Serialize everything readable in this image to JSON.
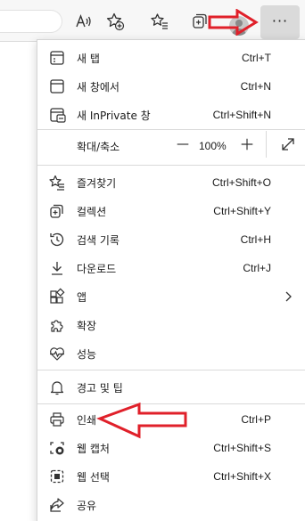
{
  "toolbar": {
    "icons": [
      "read-aloud-icon",
      "add-favorite-icon",
      "favorites-icon",
      "collections-icon",
      "profile-avatar",
      "more-options-icon"
    ],
    "more_label": "···"
  },
  "menu": {
    "new_tab": {
      "label": "새 탭",
      "shortcut": "Ctrl+T",
      "icon": "new-tab-icon"
    },
    "new_window": {
      "label": "새 창에서",
      "shortcut": "Ctrl+N",
      "icon": "new-window-icon"
    },
    "new_inprivate": {
      "label": "새 InPrivate 창",
      "shortcut": "Ctrl+Shift+N",
      "icon": "inprivate-icon"
    },
    "zoom": {
      "label": "확대/축소",
      "value": "100%",
      "minus": "—",
      "plus": "+"
    },
    "favorites": {
      "label": "즐겨찾기",
      "shortcut": "Ctrl+Shift+O",
      "icon": "favorites-icon"
    },
    "collections": {
      "label": "컬렉션",
      "shortcut": "Ctrl+Shift+Y",
      "icon": "collections-icon"
    },
    "history": {
      "label": "검색 기록",
      "shortcut": "Ctrl+H",
      "icon": "history-icon"
    },
    "downloads": {
      "label": "다운로드",
      "shortcut": "Ctrl+J",
      "icon": "download-icon"
    },
    "apps": {
      "label": "앱",
      "shortcut": "",
      "icon": "apps-icon"
    },
    "extensions": {
      "label": "확장",
      "shortcut": "",
      "icon": "extensions-icon"
    },
    "performance": {
      "label": "성능",
      "shortcut": "",
      "icon": "performance-icon"
    },
    "alerts": {
      "label": "경고 및 팁",
      "shortcut": "",
      "icon": "bell-icon"
    },
    "print": {
      "label": "인쇄",
      "shortcut": "Ctrl+P",
      "icon": "printer-icon"
    },
    "web_capture": {
      "label": "웹 캡처",
      "shortcut": "Ctrl+Shift+S",
      "icon": "web-capture-icon"
    },
    "web_select": {
      "label": "웹 선택",
      "shortcut": "Ctrl+Shift+X",
      "icon": "web-select-icon"
    },
    "share": {
      "label": "공유",
      "shortcut": "",
      "icon": "share-icon"
    }
  },
  "colors": {
    "annotation": "#e0202a",
    "more_button_bg": "#dadada",
    "menu_bg": "#ffffff",
    "separator": "#dadada"
  }
}
